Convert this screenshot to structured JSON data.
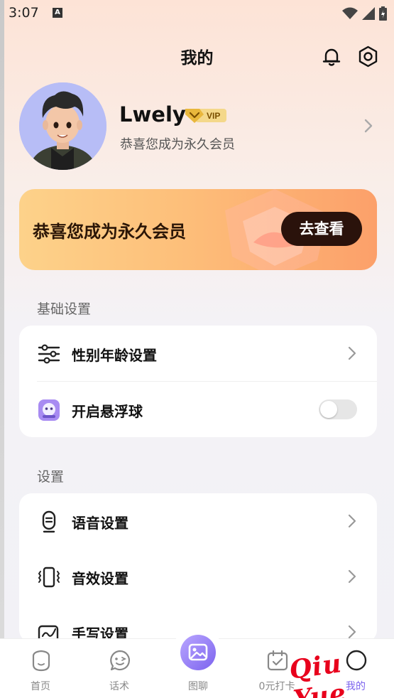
{
  "status_bar": {
    "time": "3:07",
    "notification_letter": "A"
  },
  "header": {
    "title": "我的"
  },
  "profile": {
    "username": "Lwely",
    "vip_label": "VIP",
    "subtitle": "恭喜您成为永久会员"
  },
  "banner": {
    "text": "恭喜您成为永久会员",
    "button_label": "去查看"
  },
  "basic_settings": {
    "section_label": "基础设置",
    "items": [
      {
        "label": "性别年龄设置",
        "icon": "sliders-icon"
      },
      {
        "label": "开启悬浮球",
        "icon": "floating-ball-icon",
        "toggle_on": false
      }
    ]
  },
  "settings": {
    "section_label": "设置",
    "items": [
      {
        "label": "语音设置",
        "icon": "microphone-icon"
      },
      {
        "label": "音效设置",
        "icon": "vibration-icon"
      },
      {
        "label": "手写设置",
        "icon": "handwriting-icon"
      }
    ]
  },
  "bottom_nav": {
    "items": [
      {
        "label": "首页",
        "icon": "home-icon"
      },
      {
        "label": "话术",
        "icon": "chat-face-icon"
      },
      {
        "label": "图聊",
        "icon": "image-icon"
      },
      {
        "label": "0元打卡",
        "icon": "calendar-check-icon"
      },
      {
        "label": "我的",
        "icon": "profile-icon",
        "active": true
      }
    ],
    "active_color": "#7c63ee"
  },
  "watermark": {
    "text": "Qiu  Yue"
  },
  "colors": {
    "accent": "#7c63ee",
    "banner_button": "#2a120b",
    "vip_gold": "#e9b73c"
  }
}
